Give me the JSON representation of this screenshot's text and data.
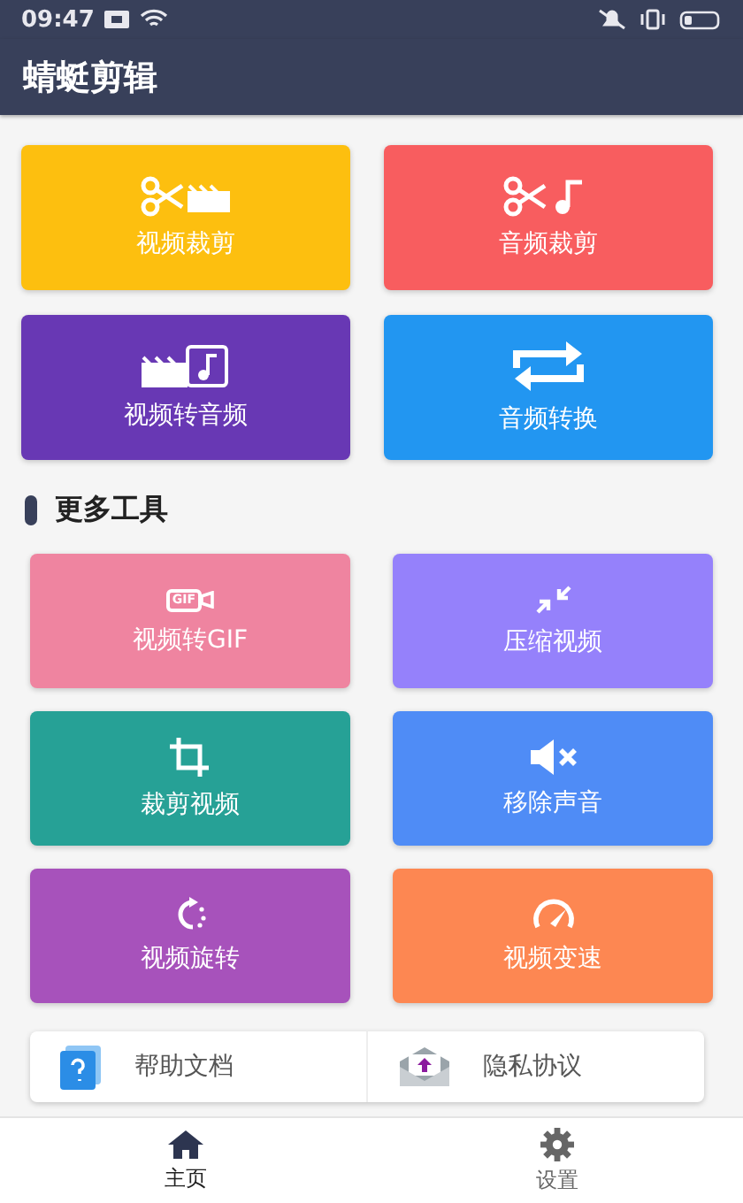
{
  "status_bar": {
    "time": "09:47"
  },
  "app_bar": {
    "title": "蜻蜓剪辑"
  },
  "main_tiles": [
    {
      "label": "视频裁剪",
      "color": "#fdbf0f"
    },
    {
      "label": "音频裁剪",
      "color": "#f85d5f"
    },
    {
      "label": "视频转音频",
      "color": "#6838b4"
    },
    {
      "label": "音频转换",
      "color": "#2296f1"
    }
  ],
  "section": {
    "title": "更多工具"
  },
  "tools": [
    {
      "label": "视频转GIF",
      "color": "#ef84a0",
      "icon_text": "GIF"
    },
    {
      "label": "压缩视频",
      "color": "#9581fb"
    },
    {
      "label": "裁剪视频",
      "color": "#26a196"
    },
    {
      "label": "移除声音",
      "color": "#4f8cf6"
    },
    {
      "label": "视频旋转",
      "color": "#a752bb"
    },
    {
      "label": "视频变速",
      "color": "#fd8752"
    }
  ],
  "links": [
    {
      "label": "帮助文档"
    },
    {
      "label": "隐私协议"
    }
  ],
  "nav": [
    {
      "label": "主页",
      "selected": true
    },
    {
      "label": "设置",
      "selected": false
    }
  ]
}
